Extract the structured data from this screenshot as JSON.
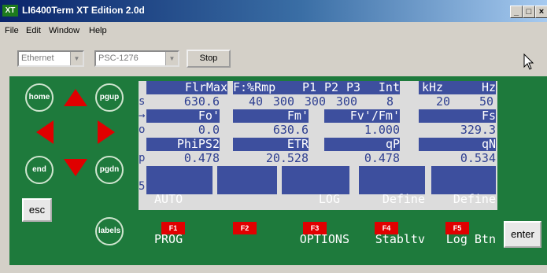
{
  "window": {
    "icon_text": "XT",
    "title": "LI6400Term  XT Edition  2.0d",
    "minimize": "_",
    "maximize": "□",
    "close": "×"
  },
  "menu": [
    "File",
    "Edit",
    "Window",
    "Help"
  ],
  "toolbar": {
    "connection": "Ethernet",
    "instrument": "PSC-1276",
    "stop_label": "Stop"
  },
  "keypad": {
    "home": "home",
    "pgup": "pgup",
    "end": "end",
    "pgdn": "pgdn",
    "labels": "labels",
    "esc": "esc",
    "enter": "enter"
  },
  "display": {
    "rows": [
      {
        "side": "",
        "cells": [
          "FlrMax",
          "F:%Rmp",
          "P1",
          "P2",
          "P3",
          "Int",
          "kHz",
          "Hz"
        ]
      },
      {
        "side": "s",
        "cells": [
          "630.6",
          "40",
          "300",
          "300",
          "300",
          "8",
          "20",
          "50"
        ]
      },
      {
        "side": "→",
        "cells": [
          "Fo'",
          "Fm'",
          "Fv'/Fm'",
          "Fs"
        ]
      },
      {
        "side": "o",
        "cells": [
          "0.0",
          "630.6",
          "1.000",
          "329.3"
        ]
      },
      {
        "side": "",
        "cells": [
          "PhiPS2",
          "ETR",
          "qP",
          "qN"
        ]
      },
      {
        "side": "p",
        "cells": [
          "0.478",
          "20.528",
          "0.478",
          "0.534"
        ]
      }
    ],
    "softkeys_side": "5",
    "softkeys": [
      {
        "line1": "AUTO",
        "line2": "PROG"
      },
      {
        "line1": "",
        "line2": ""
      },
      {
        "line1": "LOG",
        "line2": "OPTIONS"
      },
      {
        "line1": "Define",
        "line2": "Stabltv"
      },
      {
        "line1": "Define",
        "line2": "Log Btn"
      }
    ]
  },
  "function_keys": [
    "F1",
    "F2",
    "F3",
    "F4",
    "F5"
  ],
  "colors": {
    "panel_green": "#1e7a3c",
    "lcd_highlight": "#3d4f9e",
    "lcd_text": "#2e3f91",
    "key_red": "#e00000"
  }
}
